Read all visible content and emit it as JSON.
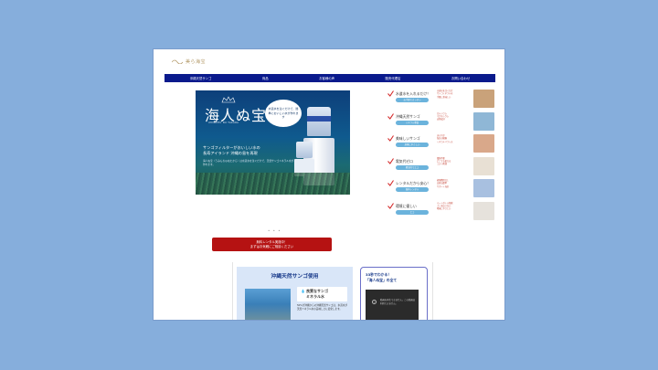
{
  "logo": {
    "text": "美ら海宝"
  },
  "nav": {
    "items": [
      "沖縄天然サンゴ",
      "商品",
      "お客様の声",
      "販売代理店",
      "お問い合わせ"
    ]
  },
  "hero": {
    "title": "海人ぬ宝",
    "subtitle": "UMINCHU NU TAKARA",
    "bubble": "水道水を注ぐだけで、簡単においしい水が作れます",
    "line1": "サンゴフィルターがおいしい水の",
    "line2": "長寿アイランド 沖縄の島を再現",
    "body": "海人ぬ宝（うみんちゅぬたから）は水道水を注ぐだけで、天然サンゴミネラル水が作れます。"
  },
  "carousel": {
    "dots": "• • •"
  },
  "cta": {
    "line1": "無料レンタル実施中！",
    "line2": "まずはお気軽にご相談ください"
  },
  "features": [
    {
      "title": "水道水を入れるだけ！",
      "pill": "お手軽でカンタン",
      "bullets": [
        "水道水を注ぐだけ",
        "サンゴミネラル水",
        "手軽に美味しい"
      ],
      "thumb_color": "#c9a27a"
    },
    {
      "title": "沖縄天然サンゴ",
      "pill": "ミネラル豊富",
      "bullets": [
        "カルシウム",
        "マグネシウム",
        "天然成分"
      ],
      "thumb_color": "#8fb7d6"
    },
    {
      "title": "美味しいサンゴ",
      "pill": "身体にやさしい",
      "bullets": [
        "まろやか",
        "毎日の健康",
        "ミネラルバランス"
      ],
      "thumb_color": "#d9a88a"
    },
    {
      "title": "電気代ゼロ",
      "pill": "経済的でエコ",
      "bullets": [
        "電源不要",
        "どこでも使える",
        "コスト削減"
      ],
      "thumb_color": "#e8e0d4"
    },
    {
      "title": "レンタルだから安心！",
      "pill": "無料レンタル",
      "bullets": [
        "初期費用なし",
        "交換も簡単",
        "サポート充実"
      ],
      "thumb_color": "#a8c0e0"
    },
    {
      "title": "環境に優しい",
      "pill": "エコ",
      "bullets": [
        "ペットボトル削減",
        "ゴミを出さない",
        "地球にやさしい"
      ],
      "thumb_color": "#e6e2dc"
    }
  ],
  "coral": {
    "heading": "沖縄天然サンゴ使用",
    "box_title1": "良質なサンゴ",
    "box_title2": "ミネラル水",
    "text": "50%が沖縄からの沖縄天然サンゴは、水道水が天然ミネラル水の美味しさに変化します。"
  },
  "video": {
    "title1": "33秒でわかる！",
    "title2": "「海人ぬ宝」の全て",
    "message": "動画を再生できません。この動画は利用できません。"
  },
  "colors": {
    "background": "#86aedc",
    "nav": "#0a1a8c",
    "cta": "#b51212",
    "accent_pill": "#6bb3dc",
    "check": "#d42a2a"
  }
}
